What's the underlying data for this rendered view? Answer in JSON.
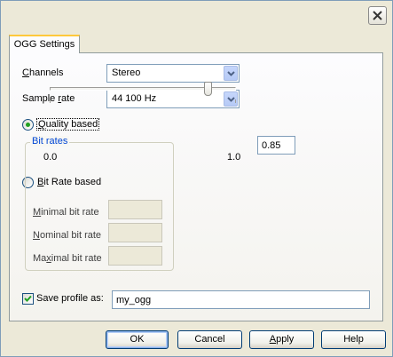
{
  "window": {
    "close_icon": "close-icon"
  },
  "tab": {
    "label": "OGG Settings"
  },
  "channels": {
    "label_pre": "",
    "label_key": "C",
    "label_post": "hannels",
    "value": "Stereo"
  },
  "sample_rate": {
    "label_pre": "Sample ",
    "label_key": "r",
    "label_post": "ate",
    "value": "44 100 Hz"
  },
  "quality": {
    "radio_selected": true,
    "label_pre": "",
    "label_key": "Q",
    "label_post": "uality based",
    "slider_min_label": "0.0",
    "slider_max_label": "1.0",
    "slider_value": 0.85,
    "value_text": "0.85"
  },
  "bitrate": {
    "radio_selected": false,
    "label_pre": "",
    "label_key": "B",
    "label_post": "it Rate based",
    "group_title": "Bit rates",
    "minimal": {
      "label_pre": "",
      "label_key": "M",
      "label_post": "inimal bit rate",
      "value": ""
    },
    "nominal": {
      "label_pre": "",
      "label_key": "N",
      "label_post": "ominal bit rate",
      "value": ""
    },
    "maximal": {
      "label_pre": "Ma",
      "label_key": "x",
      "label_post": "imal bit rate",
      "value": ""
    }
  },
  "profile": {
    "checked": true,
    "label": "Save profile as:",
    "value": "my_ogg"
  },
  "buttons": {
    "ok": "OK",
    "cancel": "Cancel",
    "apply_key": "A",
    "apply_rest": "pply",
    "help": "Help"
  },
  "colors": {
    "background": "#ece9d8",
    "group_title": "#0046d5",
    "radio_dot": "#21a121",
    "tab_highlight": "#ffc83c"
  }
}
